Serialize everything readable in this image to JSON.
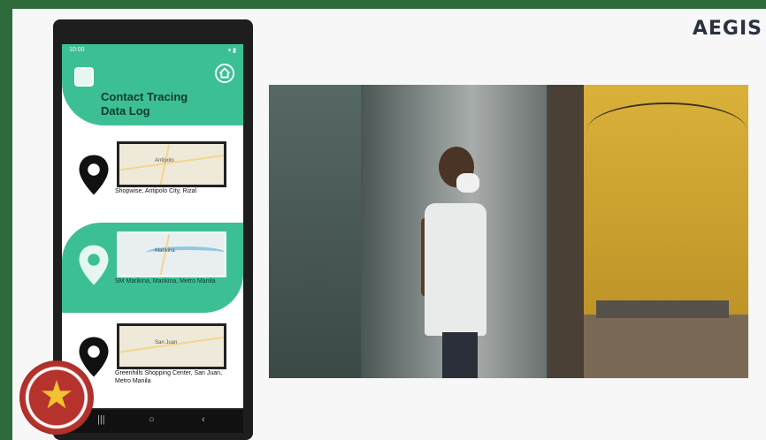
{
  "brand": {
    "logo_text": "AEGIS"
  },
  "phone": {
    "status": {
      "time": "10:00",
      "icons": "▾ ▮"
    },
    "app": {
      "title_line1": "Contact Tracing",
      "title_line2": "Data Log",
      "icons": {
        "app": "app-icon",
        "home": "home-icon"
      }
    },
    "entries": [
      {
        "address": "Shopwise, Antipolo City, Rizal",
        "map_label": "Antipolo",
        "active": false
      },
      {
        "address": "SM Marikina, Marikina, Metro Manila",
        "map_label": "Marikina",
        "active": true
      },
      {
        "address": "Greenhills Shopping Center, San Juan, Metro Manila",
        "map_label": "San Juan",
        "active": false
      }
    ],
    "navbar": {
      "recent": "|||",
      "home": "○",
      "back": "‹"
    }
  },
  "colors": {
    "accent": "#3dbf95",
    "border": "#2f6b3a",
    "seal_red": "#b6332d",
    "seal_gold": "#f1c232"
  }
}
